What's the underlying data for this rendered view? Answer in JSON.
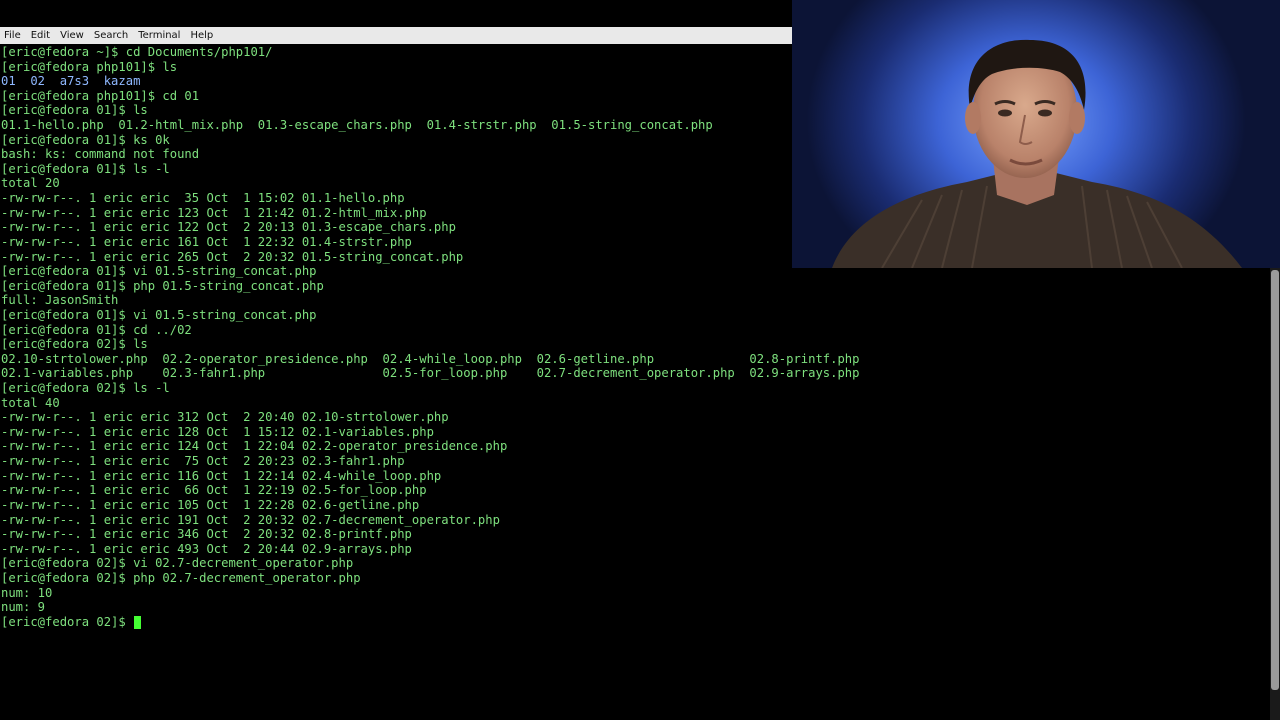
{
  "menubar": {
    "items": [
      "File",
      "Edit",
      "View",
      "Search",
      "Terminal",
      "Help"
    ]
  },
  "terminal": {
    "lines": [
      "[eric@fedora ~]$ cd Documents/php101/",
      "[eric@fedora php101]$ ls",
      "01  02  a7s3  kazam",
      "[eric@fedora php101]$ cd 01",
      "[eric@fedora 01]$ ls",
      "01.1-hello.php  01.2-html_mix.php  01.3-escape_chars.php  01.4-strstr.php  01.5-string_concat.php",
      "[eric@fedora 01]$ ks 0k",
      "bash: ks: command not found",
      "[eric@fedora 01]$ ls -l",
      "total 20",
      "-rw-rw-r--. 1 eric eric  35 Oct  1 15:02 01.1-hello.php",
      "-rw-rw-r--. 1 eric eric 123 Oct  1 21:42 01.2-html_mix.php",
      "-rw-rw-r--. 1 eric eric 122 Oct  2 20:13 01.3-escape_chars.php",
      "-rw-rw-r--. 1 eric eric 161 Oct  1 22:32 01.4-strstr.php",
      "-rw-rw-r--. 1 eric eric 265 Oct  2 20:32 01.5-string_concat.php",
      "[eric@fedora 01]$ vi 01.5-string_concat.php",
      "[eric@fedora 01]$ php 01.5-string_concat.php",
      "full: JasonSmith",
      "[eric@fedora 01]$ vi 01.5-string_concat.php",
      "[eric@fedora 01]$ cd ../02",
      "[eric@fedora 02]$ ls",
      "02.10-strtolower.php  02.2-operator_presidence.php  02.4-while_loop.php  02.6-getline.php             02.8-printf.php",
      "02.1-variables.php    02.3-fahr1.php                02.5-for_loop.php    02.7-decrement_operator.php  02.9-arrays.php",
      "[eric@fedora 02]$ ls -l",
      "total 40",
      "-rw-rw-r--. 1 eric eric 312 Oct  2 20:40 02.10-strtolower.php",
      "-rw-rw-r--. 1 eric eric 128 Oct  1 15:12 02.1-variables.php",
      "-rw-rw-r--. 1 eric eric 124 Oct  1 22:04 02.2-operator_presidence.php",
      "-rw-rw-r--. 1 eric eric  75 Oct  2 20:23 02.3-fahr1.php",
      "-rw-rw-r--. 1 eric eric 116 Oct  1 22:14 02.4-while_loop.php",
      "-rw-rw-r--. 1 eric eric  66 Oct  1 22:19 02.5-for_loop.php",
      "-rw-rw-r--. 1 eric eric 105 Oct  1 22:28 02.6-getline.php",
      "-rw-rw-r--. 1 eric eric 191 Oct  2 20:32 02.7-decrement_operator.php",
      "-rw-rw-r--. 1 eric eric 346 Oct  2 20:32 02.8-printf.php",
      "-rw-rw-r--. 1 eric eric 493 Oct  2 20:44 02.9-arrays.php",
      "[eric@fedora 02]$ vi 02.7-decrement_operator.php",
      "[eric@fedora 02]$ php 02.7-decrement_operator.php",
      "num: 10",
      "num: 9",
      "[eric@fedora 02]$ "
    ],
    "directory_line_index": 2,
    "colors": {
      "text": "#7ee07e",
      "directory": "#8fb8ff",
      "cursor": "#44ff33",
      "background": "#000000"
    }
  },
  "webcam": {
    "description_icon": "presenter-webcam-icon"
  }
}
